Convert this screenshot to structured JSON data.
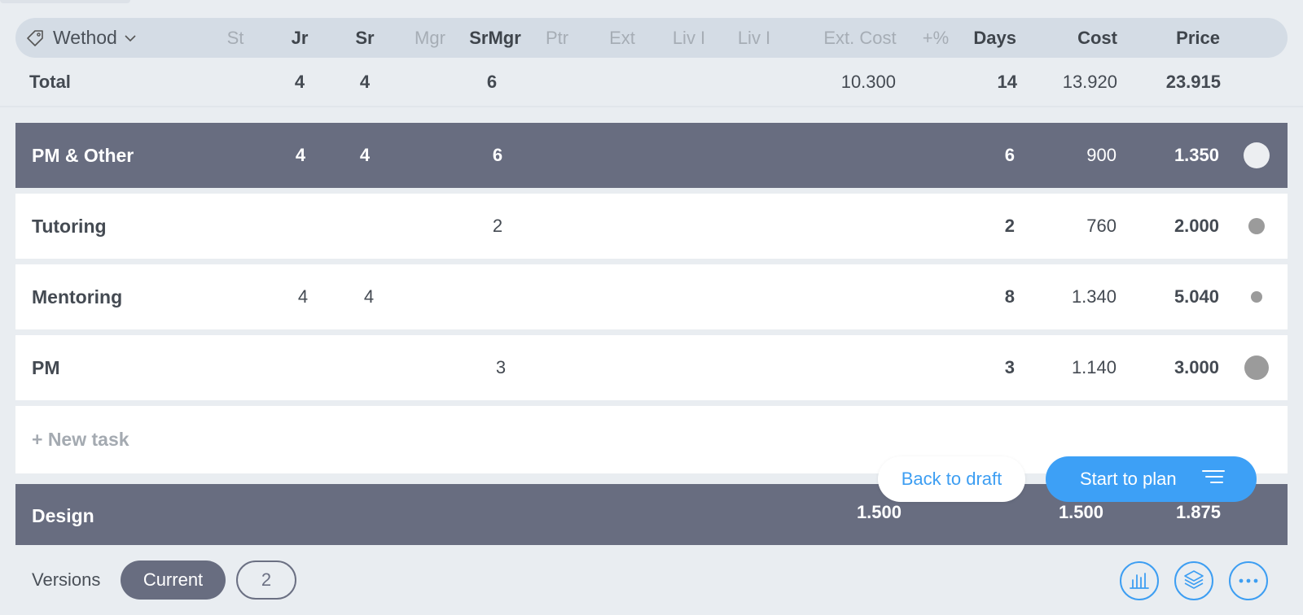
{
  "header": {
    "method_label": "Wethod",
    "columns": {
      "st": "St",
      "jr": "Jr",
      "sr": "Sr",
      "mgr": "Mgr",
      "srmgr": "SrMgr",
      "ptr": "Ptr",
      "ext": "Ext",
      "liv1": "Liv I",
      "liv2": "Liv I",
      "ext_cost": "Ext. Cost",
      "markup": "+%",
      "days": "Days",
      "cost": "Cost",
      "price": "Price"
    }
  },
  "total": {
    "label": "Total",
    "jr": "4",
    "sr": "4",
    "srmgr": "6",
    "ext_cost": "10.300",
    "days": "14",
    "cost": "13.920",
    "price": "23.915"
  },
  "groups": [
    {
      "label": "PM & Other",
      "jr": "4",
      "sr": "4",
      "srmgr": "6",
      "days": "6",
      "cost": "900",
      "price": "1.350"
    },
    {
      "label": "Design",
      "ext_cost": "1.500",
      "cost": "1.500",
      "price": "1.875"
    }
  ],
  "tasks": [
    {
      "label": "Tutoring",
      "srmgr": "2",
      "days": "2",
      "cost": "760",
      "price": "2.000"
    },
    {
      "label": "Mentoring",
      "jr": "4",
      "sr": "4",
      "days": "8",
      "cost": "1.340",
      "price": "5.040"
    },
    {
      "label": "PM",
      "srmgr": "3",
      "days": "3",
      "cost": "1.140",
      "price": "3.000"
    }
  ],
  "new_task_label": "+ New task",
  "actions": {
    "back_to_draft": "Back to draft",
    "start_to_plan": "Start to plan"
  },
  "footer": {
    "versions_label": "Versions",
    "current_label": "Current",
    "version_2_label": "2"
  },
  "icons": [
    "tag-icon",
    "chevron-down-icon",
    "list-icon",
    "bar-chart-icon",
    "layers-icon",
    "more-icon"
  ],
  "colors": {
    "accent": "#3da0f6",
    "group_row": "#686d80",
    "header_bg": "#d4dce5",
    "status_dot": "#9b9b9b"
  }
}
